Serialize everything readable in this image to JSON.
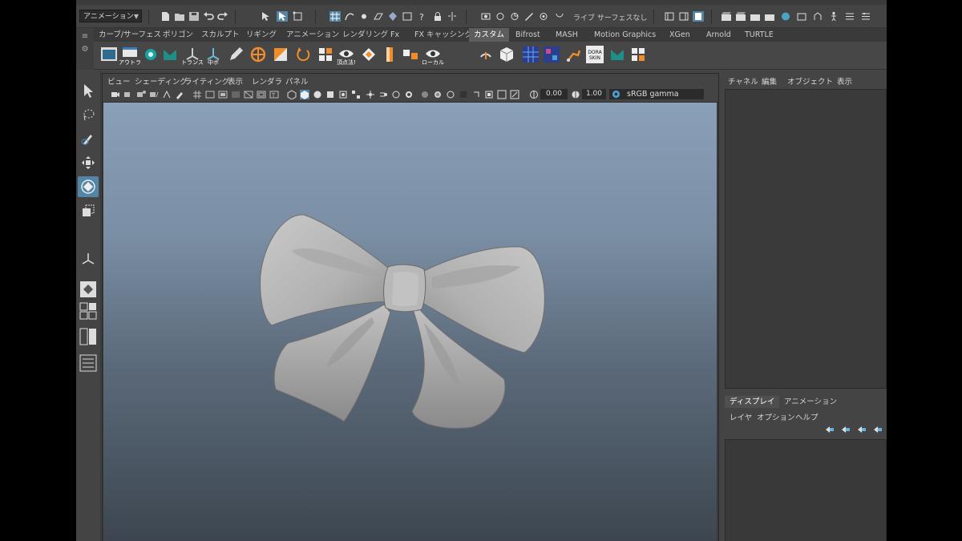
{
  "status_line": {
    "mode_value": "アニメーション",
    "live_label": "ライブ",
    "surface_label": "サーフェスなし"
  },
  "shelf": {
    "tabs": [
      "カーブ/サーフェス",
      "ポリゴン",
      "スカルプト",
      "リギング",
      "アニメーション",
      "レンダリング",
      "Fx",
      "FX キャッシング",
      "カスタム",
      "Bifrost",
      "MASH",
      "Motion Graphics",
      "XGen",
      "Arnold",
      "TURTLE"
    ],
    "active_tab": "カスタム",
    "icon_labels": {
      "outliner": "アウトラ",
      "trans": "トランス",
      "pivot": "中ボ",
      "vertex": "頂点法!",
      "local": "ローカル",
      "dora_skin": "DORA SKIN"
    }
  },
  "viewport_panel": {
    "menu": [
      "ビュー",
      "シェーディング",
      "ライティング",
      "表示",
      "レンダラ",
      "パネル"
    ],
    "exposure": "0.00",
    "gamma_value": "1.00",
    "color_space": "sRGB gamma"
  },
  "channel_box": {
    "menu": [
      "チャネル",
      "編集",
      "オブジェクト",
      "表示"
    ]
  },
  "layer_editor": {
    "tabs": [
      "ディスプレイ",
      "アニメーション"
    ],
    "active_tab": "ディスプレイ",
    "menu": [
      "レイヤ",
      "オプション",
      "ヘルプ"
    ]
  },
  "scene": {
    "object": "ribbon-bow",
    "object_color": "#bdbdbd"
  },
  "colors": {
    "accent": "#5285a6",
    "panel": "#444444",
    "viewport_top": "#8aa0b8",
    "viewport_bottom": "#3d4650"
  }
}
